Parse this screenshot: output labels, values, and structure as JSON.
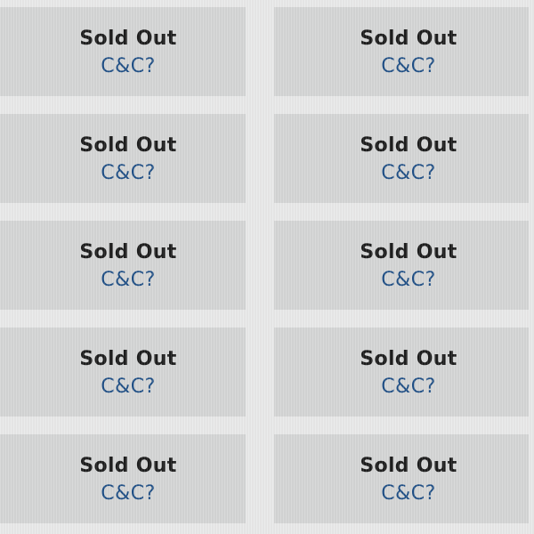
{
  "grid": {
    "cells": [
      {
        "status": "Sold Out",
        "action": "C&C?"
      },
      {
        "status": "Sold Out",
        "action": "C&C?"
      },
      {
        "status": "Sold Out",
        "action": "C&C?"
      },
      {
        "status": "Sold Out",
        "action": "C&C?"
      },
      {
        "status": "Sold Out",
        "action": "C&C?"
      },
      {
        "status": "Sold Out",
        "action": "C&C?"
      },
      {
        "status": "Sold Out",
        "action": "C&C?"
      },
      {
        "status": "Sold Out",
        "action": "C&C?"
      },
      {
        "status": "Sold Out",
        "action": "C&C?"
      },
      {
        "status": "Sold Out",
        "action": "C&C?"
      }
    ]
  },
  "colors": {
    "background": "#e9eaea",
    "cell_background": "#d5d6d6",
    "status_text": "#1d1d1d",
    "action_link": "#1f4f86"
  }
}
